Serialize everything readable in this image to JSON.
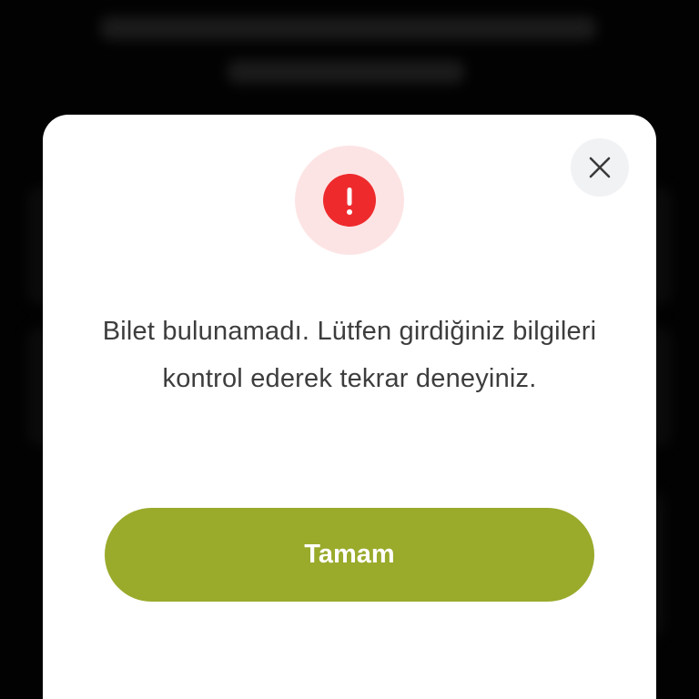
{
  "dialog": {
    "message": "Bilet bulunamadı. Lütfen girdiğiniz bilgileri kontrol ederek tekrar deneyiniz.",
    "confirm_label": "Tamam",
    "close_icon": "close-icon",
    "alert_icon": "exclamation-icon"
  },
  "colors": {
    "accent": "#9aaa2b",
    "alert_red": "#ee2a2d",
    "alert_halo": "#fde4e4",
    "text": "#3d3d3d",
    "backdrop": "#050505"
  }
}
